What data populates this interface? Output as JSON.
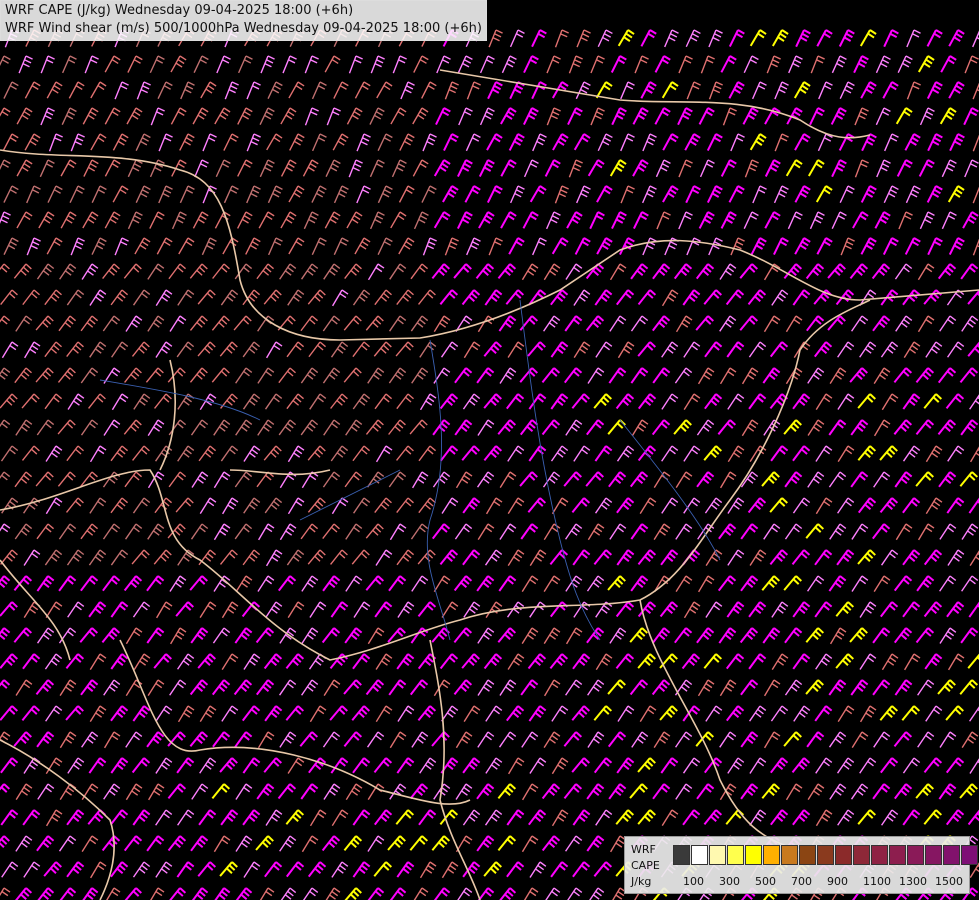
{
  "header": {
    "line1": "WRF CAPE (J/kg) Wednesday 09-04-2025 18:00 (+6h)",
    "line2": "WRF Wind shear (m/s) 500/1000hPa Wednesday 09-04-2025 18:00 (+6h)"
  },
  "legend": {
    "label_model": "WRF",
    "label_var": "CAPE",
    "label_unit": "J/kg",
    "colors": [
      "#3a3a3a",
      "#ffffff",
      "#fff9b0",
      "#ffff4d",
      "#ffff00",
      "#ffb000",
      "#c87a1e",
      "#8b4513",
      "#8a3a1e",
      "#8b2a2a",
      "#8e2838",
      "#8f2244",
      "#8d1e4e",
      "#8a1a58",
      "#861662",
      "#82126c",
      "#7e0e76",
      "#7a0a80"
    ],
    "ticks": [
      "100",
      "300",
      "500",
      "700",
      "900",
      "1100",
      "1300",
      "1500"
    ]
  },
  "map": {
    "background": "#000000",
    "border_color": "#e8c8a8",
    "river_color": "#3a5fb0",
    "barb_colors": [
      "#c07070",
      "#e07070",
      "#ff80ff",
      "#ff00ff",
      "#ffff00"
    ],
    "content": "wind-shear-barbs-and-country-borders"
  }
}
